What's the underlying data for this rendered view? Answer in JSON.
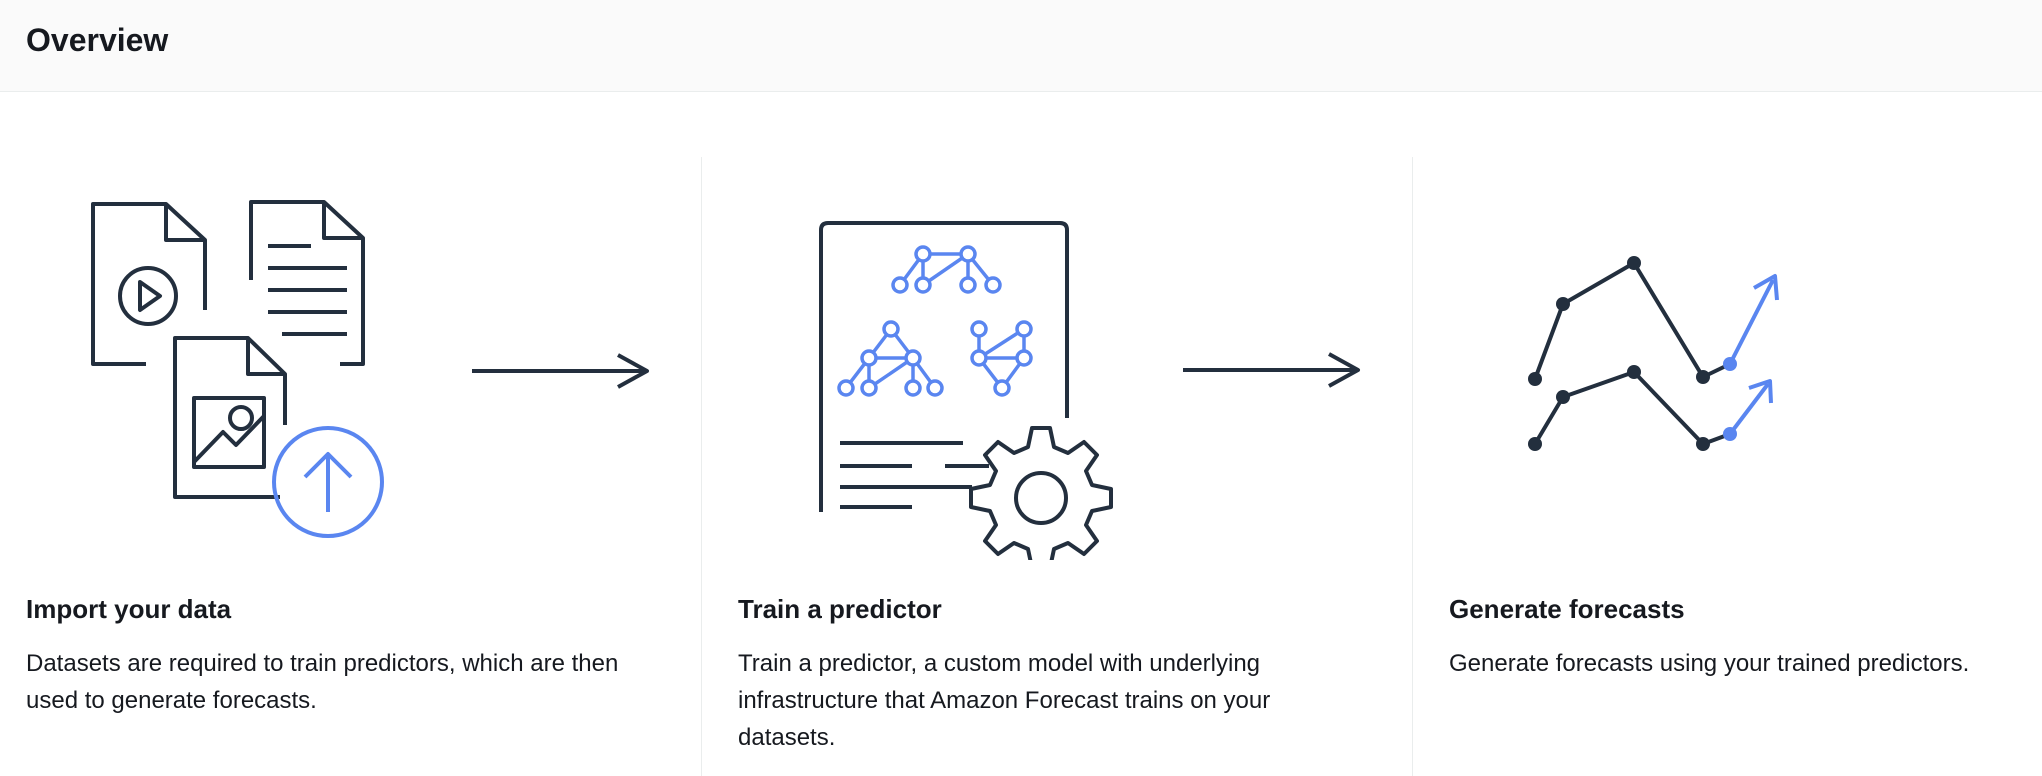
{
  "header": {
    "title": "Overview"
  },
  "colors": {
    "ink": "#232f3e",
    "accent": "#5a86f0",
    "divider": "#eaeded"
  },
  "steps": [
    {
      "title": "Import your data",
      "description": "Datasets are required to train predictors, which are then used to generate forecasts.",
      "icon": "import-data-icon"
    },
    {
      "title": "Train a predictor",
      "description": "Train a predictor, a custom model with underlying infrastructure that Amazon Forecast trains on your datasets.",
      "icon": "train-predictor-icon"
    },
    {
      "title": "Generate forecasts",
      "description": "Generate forecasts using your trained predictors.",
      "icon": "generate-forecasts-icon"
    }
  ]
}
